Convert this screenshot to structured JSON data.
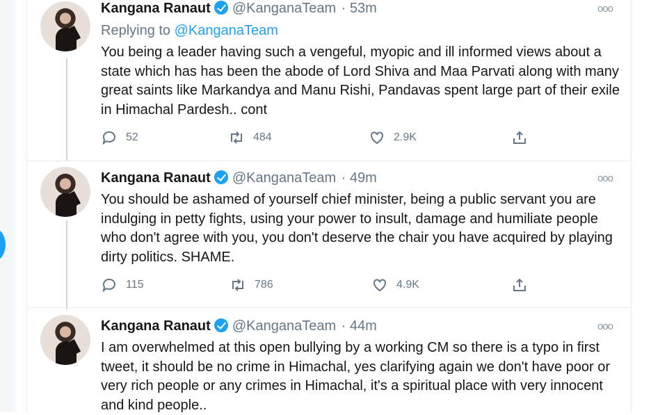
{
  "tweets": [
    {
      "author": "Kangana Ranaut",
      "handle": "@KanganaTeam",
      "time": "· 53m",
      "replying_label": "Replying to ",
      "replying_to": "@KanganaTeam",
      "text": "You being a leader having such a vengeful, myopic and ill informed views about a state which has has been the abode of Lord Shiva and Maa Parvati along with many great saints like Markandya and Manu Rishi, Pandavas spent large part of their exile in Himachal Pardesh.. cont",
      "replies": "52",
      "retweets": "484",
      "likes": "2.9K"
    },
    {
      "author": "Kangana Ranaut",
      "handle": "@KanganaTeam",
      "time": "· 49m",
      "text": "You should be ashamed of yourself chief minister, being a public servant you are indulging in petty fights, using your power to insult, damage and humiliate people who don't agree with you, you don't deserve the chair you have acquired by playing dirty politics. SHAME.",
      "replies": "115",
      "retweets": "786",
      "likes": "4.9K"
    },
    {
      "author": "Kangana Ranaut",
      "handle": "@KanganaTeam",
      "time": "· 44m",
      "text": "I am overwhelmed at this open bullying by a working CM so there is a typo in first tweet, it should be no crime in Himachal, yes clarifying again we don't have poor or very rich people or any crimes in Himachal, it's a spiritual place with very innocent and kind people..",
      "replies": "",
      "retweets": "",
      "likes": ""
    }
  ],
  "colors": {
    "accent": "#1da1f2",
    "secondary_text": "#657786",
    "border": "#e6ecf0"
  },
  "icons": [
    "reply-icon",
    "retweet-icon",
    "like-icon",
    "share-icon",
    "more-icon",
    "verified-badge-icon"
  ]
}
